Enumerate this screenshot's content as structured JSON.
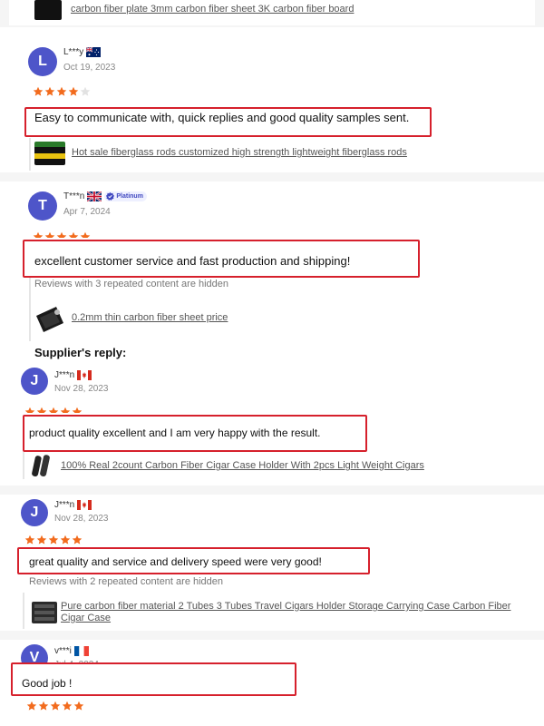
{
  "top_product": "carbon fiber plate 3mm carbon fiber sheet 3K carbon fiber board",
  "reviews": [
    {
      "initial": "L",
      "name": "L***y",
      "date": "Oct 19, 2023",
      "rating": 4,
      "text": "Easy to communicate with, quick replies and good quality samples sent.",
      "product": "Hot sale fiberglass rods customized high strength lightweight fiberglass rods",
      "flag": "australia-flag-icon"
    },
    {
      "initial": "T",
      "name": "T***n",
      "badge": "Platinum",
      "date": "Apr 7, 2024",
      "rating": 5,
      "text": "excellent customer service and fast production and shipping!",
      "hidden_note": "Reviews with 3 repeated content are hidden",
      "product": "0.2mm thin carbon fiber sheet price",
      "flag": "uk-flag-icon"
    },
    {
      "initial": "J",
      "name": "J***n",
      "date": "Nov 28, 2023",
      "rating": 5,
      "text": "product quality excellent and I am very happy with the result.",
      "product": "100% Real 2count Carbon Fiber Cigar Case Holder With 2pcs Light Weight Cigars",
      "flag": "canada-flag-icon"
    },
    {
      "initial": "J",
      "name": "J***n",
      "date": "Nov 28, 2023",
      "rating": 5,
      "text": "great quality and service and delivery speed were very good!",
      "hidden_note": "Reviews with 2 repeated content are hidden",
      "product": "Pure carbon fiber material 2 Tubes 3 Tubes Travel Cigars Holder Storage Carrying Case Carbon Fiber Cigar Case",
      "flag": "canada-flag-icon"
    },
    {
      "initial": "V",
      "name": "v***i",
      "date": "Jul 4, 2024",
      "rating": 5,
      "text": "Good job !",
      "flag": "france-flag-icon"
    }
  ],
  "supplier_reply_label": "Supplier's reply:",
  "colors": {
    "avatar": "#4e55c9",
    "star": "#f26b1d",
    "highlight": "#d6202c"
  }
}
